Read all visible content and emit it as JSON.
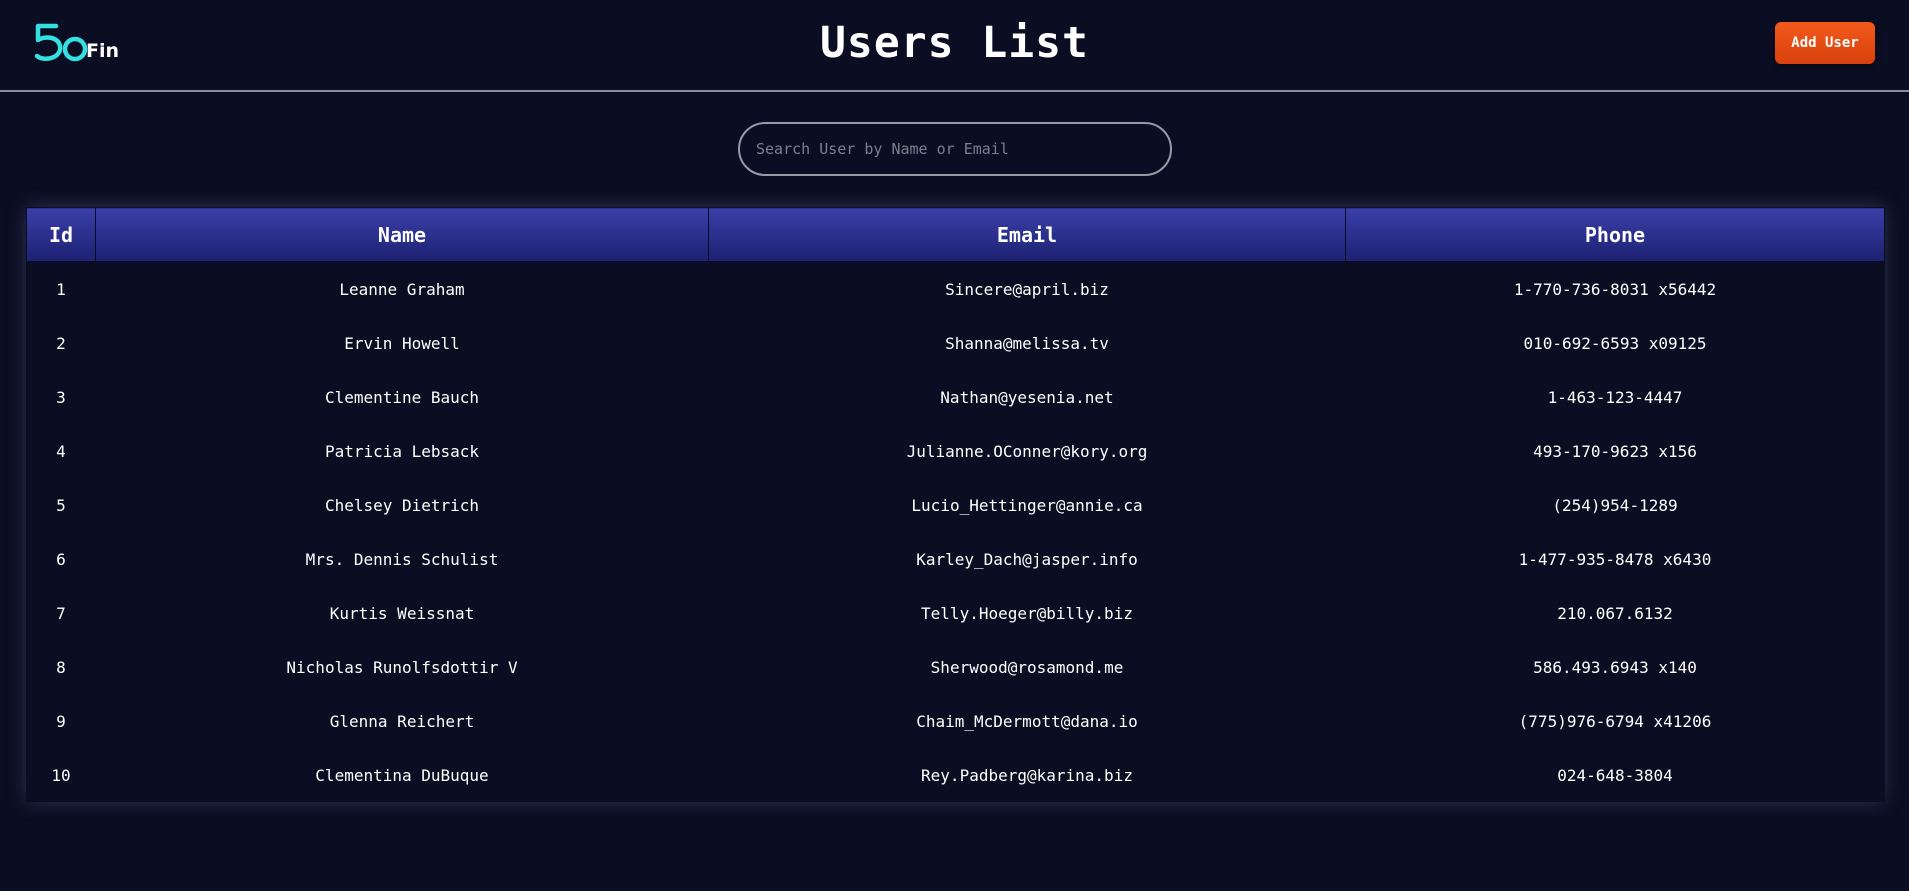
{
  "header": {
    "logo_text": "Fin",
    "title": "Users List",
    "add_user_label": "Add User"
  },
  "search": {
    "placeholder": "Search User by Name or Email",
    "value": ""
  },
  "table": {
    "columns": [
      "Id",
      "Name",
      "Email",
      "Phone"
    ],
    "rows": [
      {
        "id": "1",
        "name": "Leanne Graham",
        "email": "Sincere@april.biz",
        "phone": "1-770-736-8031 x56442"
      },
      {
        "id": "2",
        "name": "Ervin Howell",
        "email": "Shanna@melissa.tv",
        "phone": "010-692-6593 x09125"
      },
      {
        "id": "3",
        "name": "Clementine Bauch",
        "email": "Nathan@yesenia.net",
        "phone": "1-463-123-4447"
      },
      {
        "id": "4",
        "name": "Patricia Lebsack",
        "email": "Julianne.OConner@kory.org",
        "phone": "493-170-9623 x156"
      },
      {
        "id": "5",
        "name": "Chelsey Dietrich",
        "email": "Lucio_Hettinger@annie.ca",
        "phone": "(254)954-1289"
      },
      {
        "id": "6",
        "name": "Mrs. Dennis Schulist",
        "email": "Karley_Dach@jasper.info",
        "phone": "1-477-935-8478 x6430"
      },
      {
        "id": "7",
        "name": "Kurtis Weissnat",
        "email": "Telly.Hoeger@billy.biz",
        "phone": "210.067.6132"
      },
      {
        "id": "8",
        "name": "Nicholas Runolfsdottir V",
        "email": "Sherwood@rosamond.me",
        "phone": "586.493.6943 x140"
      },
      {
        "id": "9",
        "name": "Glenna Reichert",
        "email": "Chaim_McDermott@dana.io",
        "phone": "(775)976-6794 x41206"
      },
      {
        "id": "10",
        "name": "Clementina DuBuque",
        "email": "Rey.Padberg@karina.biz",
        "phone": "024-648-3804"
      }
    ]
  },
  "colors": {
    "background": "#0b0d22",
    "header_gradient_top": "#3a3fa8",
    "header_gradient_bottom": "#1c2172",
    "accent_button": "#f25a1c",
    "logo_accent": "#35e0e0"
  },
  "icons": {
    "logo": "50fin-logo"
  }
}
